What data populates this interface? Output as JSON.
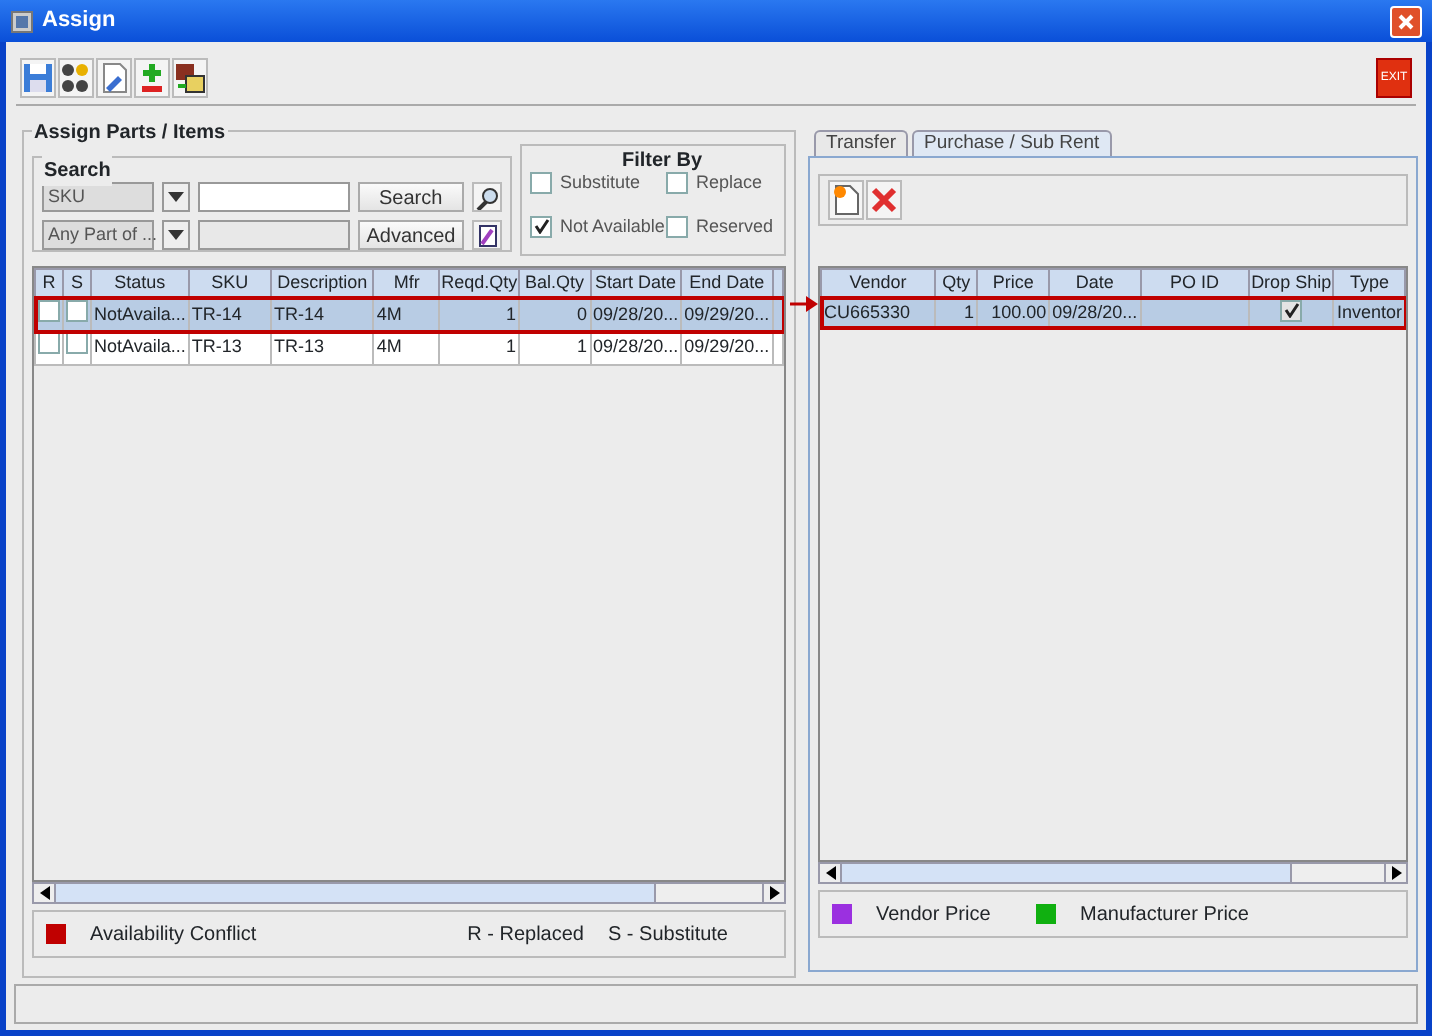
{
  "window": {
    "title": "Assign"
  },
  "exit_button": {
    "label": "EXIT"
  },
  "assign_panel": {
    "title": "Assign Parts / Items",
    "search": {
      "title": "Search",
      "field": "SKU",
      "match": "Any Part of ...",
      "buttons": [
        "Search",
        "Advanced"
      ]
    },
    "filter": {
      "title": "Filter By",
      "options": [
        {
          "label": "Substitute",
          "checked": false
        },
        {
          "label": "Replace",
          "checked": false
        },
        {
          "label": "Not Available",
          "checked": true
        },
        {
          "label": "Reserved",
          "checked": false
        }
      ]
    },
    "table": {
      "columns": [
        "R",
        "S",
        "Status",
        "SKU",
        "Description",
        "Mfr",
        "Reqd.Qty",
        "Bal.Qty",
        "Start Date",
        "End Date"
      ],
      "rows": [
        {
          "selected": true,
          "replaced": false,
          "substitute": false,
          "cells": [
            "",
            "",
            "NotAvaila...",
            "TR-14",
            "TR-14",
            "4M",
            "1",
            "0",
            "09/28/20...",
            "09/29/20..."
          ]
        },
        {
          "selected": false,
          "replaced": false,
          "substitute": false,
          "cells": [
            "",
            "",
            "NotAvaila...",
            "TR-13",
            "TR-13",
            "4M",
            "1",
            "1",
            "09/28/20...",
            "09/29/20..."
          ]
        }
      ]
    },
    "legend": [
      {
        "color": "#c00000",
        "label": "Availability Conflict"
      }
    ],
    "notes": [
      "R - Replaced",
      "S - Substitute"
    ]
  },
  "side_panel": {
    "tabs": [
      {
        "label": "Transfer",
        "selected": false
      },
      {
        "label": "Purchase / Sub Rent",
        "selected": true
      }
    ],
    "table": {
      "columns": [
        "Vendor",
        "Qty",
        "Price",
        "Date",
        "PO ID",
        "Drop Ship",
        "Type"
      ],
      "rows": [
        {
          "selected": true,
          "drop_ship": true,
          "cells": [
            "CU665330",
            "1",
            "100.00",
            "09/28/20...",
            ""
          ]
        }
      ],
      "type_cells": [
        "Inventor"
      ]
    },
    "legend": [
      {
        "color": "#9b30e0",
        "label": "Vendor Price"
      },
      {
        "color": "#10b010",
        "label": "Manufacturer Price"
      }
    ]
  }
}
